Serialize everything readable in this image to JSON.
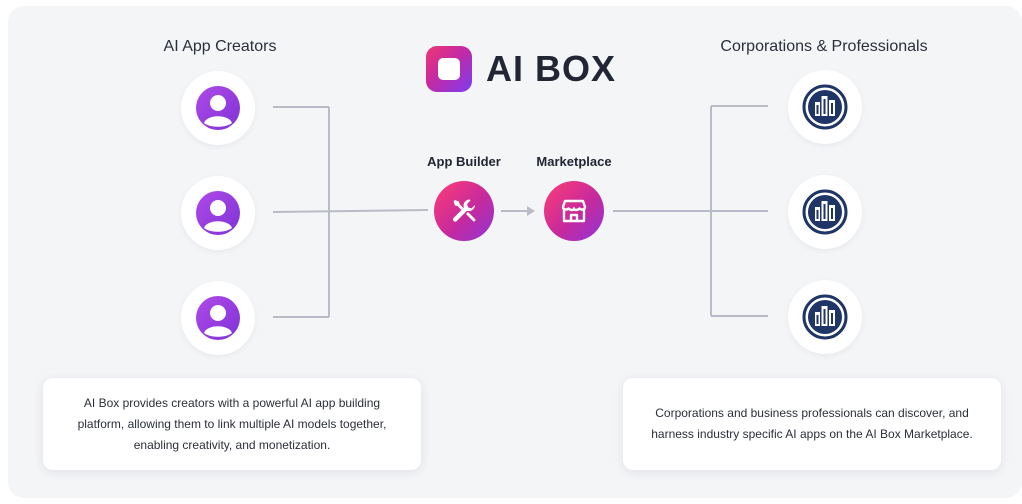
{
  "brand": {
    "name": "AI BOX"
  },
  "left": {
    "heading": "AI App Creators",
    "nodes": [
      {
        "icon": "user-avatar-icon"
      },
      {
        "icon": "user-avatar-icon"
      },
      {
        "icon": "user-avatar-icon"
      }
    ],
    "description": "AI Box provides creators with a powerful AI app building platform, allowing them to link multiple AI models together, enabling creativity, and monetization."
  },
  "center": {
    "steps": [
      {
        "label": "App Builder",
        "icon": "tools-icon"
      },
      {
        "label": "Marketplace",
        "icon": "storefront-icon"
      }
    ]
  },
  "right": {
    "heading": "Corporations & Professionals",
    "nodes": [
      {
        "icon": "buildings-icon"
      },
      {
        "icon": "buildings-icon"
      },
      {
        "icon": "buildings-icon"
      }
    ],
    "description": "Corporations and business professionals can discover, and harness industry specific AI apps on the AI Box Marketplace."
  },
  "colors": {
    "accent_pink": "#f0386e",
    "accent_purple": "#7a3df0",
    "building_navy": "#1f3566",
    "connector": "#b9bcc6"
  }
}
